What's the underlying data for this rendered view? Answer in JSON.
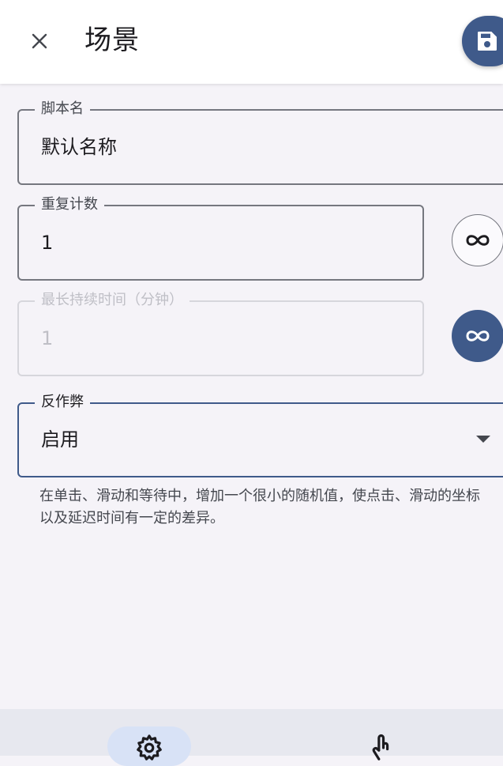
{
  "appbar": {
    "title": "场景",
    "close_icon": "close-icon",
    "save_icon": "save-icon"
  },
  "form": {
    "script_name": {
      "label": "脚本名",
      "value": "默认名称"
    },
    "repeat_count": {
      "label": "重复计数",
      "value": "1",
      "toggle_icon": "infinity-icon"
    },
    "max_duration": {
      "label": "最长持续时间（分钟）",
      "value": "1",
      "disabled": true,
      "toggle_icon": "infinity-icon"
    },
    "anti_cheat": {
      "label": "反作弊",
      "selected": "启用"
    },
    "help_text": "在单击、滑动和等待中，增加一个很小的随机值，使点击、滑动的坐标以及延迟时间有一定的差异。"
  },
  "bottom_nav": {
    "items": [
      {
        "icon": "settings-icon",
        "selected": true
      },
      {
        "icon": "touch-icon",
        "selected": false
      }
    ]
  },
  "colors": {
    "primary": "#3f5a8a",
    "background": "#f5f3f8",
    "appbar": "#ffffff",
    "outline": "#75777f"
  }
}
